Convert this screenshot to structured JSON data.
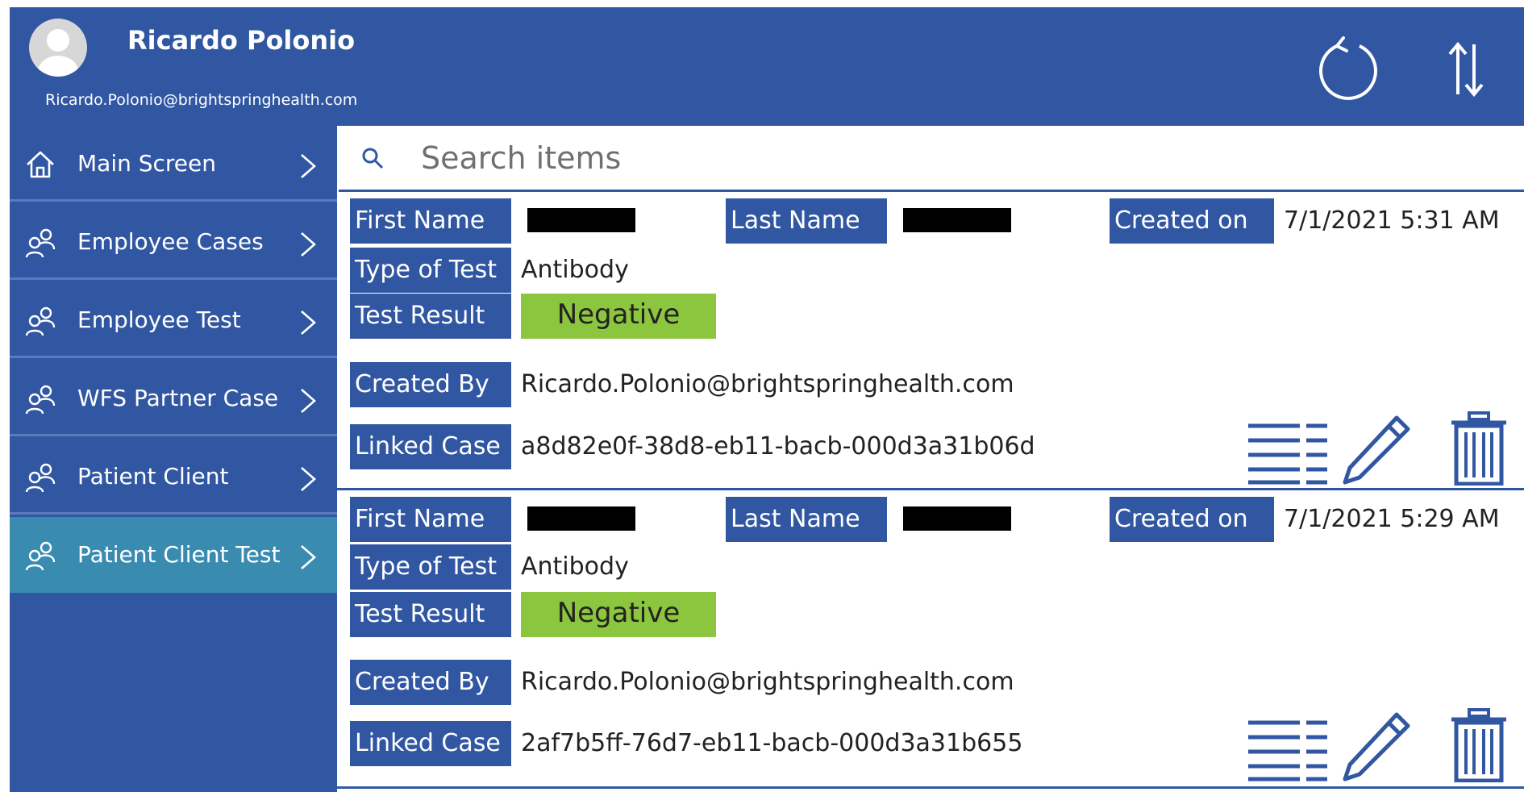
{
  "header": {
    "user_name": "Ricardo Polonio",
    "user_email": "Ricardo.Polonio@brightspringhealth.com",
    "icons": {
      "avatar": "user-avatar-icon",
      "refresh": "refresh-icon",
      "sort": "sort-icon"
    }
  },
  "sidebar": {
    "items": [
      {
        "label": "Main Screen",
        "icon": "home-icon",
        "active": false
      },
      {
        "label": "Employee Cases",
        "icon": "people-icon",
        "active": false
      },
      {
        "label": "Employee Test",
        "icon": "people-icon",
        "active": false
      },
      {
        "label": "WFS Partner Case",
        "icon": "people-icon",
        "active": false
      },
      {
        "label": "Patient Client",
        "icon": "people-icon",
        "active": false
      },
      {
        "label": "Patient Client Test",
        "icon": "people-icon",
        "active": true
      }
    ]
  },
  "search": {
    "placeholder": "Search items",
    "value": ""
  },
  "labels": {
    "first_name": "First Name",
    "last_name": "Last Name",
    "created_on": "Created on",
    "type_of_test": "Type of Test",
    "test_result": "Test Result",
    "created_by": "Created By",
    "linked_case": "Linked Case"
  },
  "records": [
    {
      "first_name": "",
      "last_name": "",
      "created_on": "7/1/2021 5:31 AM",
      "type_of_test": "Antibody",
      "test_result": "Negative",
      "created_by": "Ricardo.Polonio@brightspringhealth.com",
      "linked_case": "a8d82e0f-38d8-eb11-bacb-000d3a31b06d"
    },
    {
      "first_name": "",
      "last_name": "",
      "created_on": "7/1/2021 5:29 AM",
      "type_of_test": "Antibody",
      "test_result": "Negative",
      "created_by": "Ricardo.Polonio@brightspringhealth.com",
      "linked_case": "2af7b5ff-76d7-eb11-bacb-000d3a31b655"
    }
  ],
  "colors": {
    "brand_blue": "#3157a2",
    "active_nav": "#3a8bb0",
    "negative_green": "#8cc63f"
  }
}
